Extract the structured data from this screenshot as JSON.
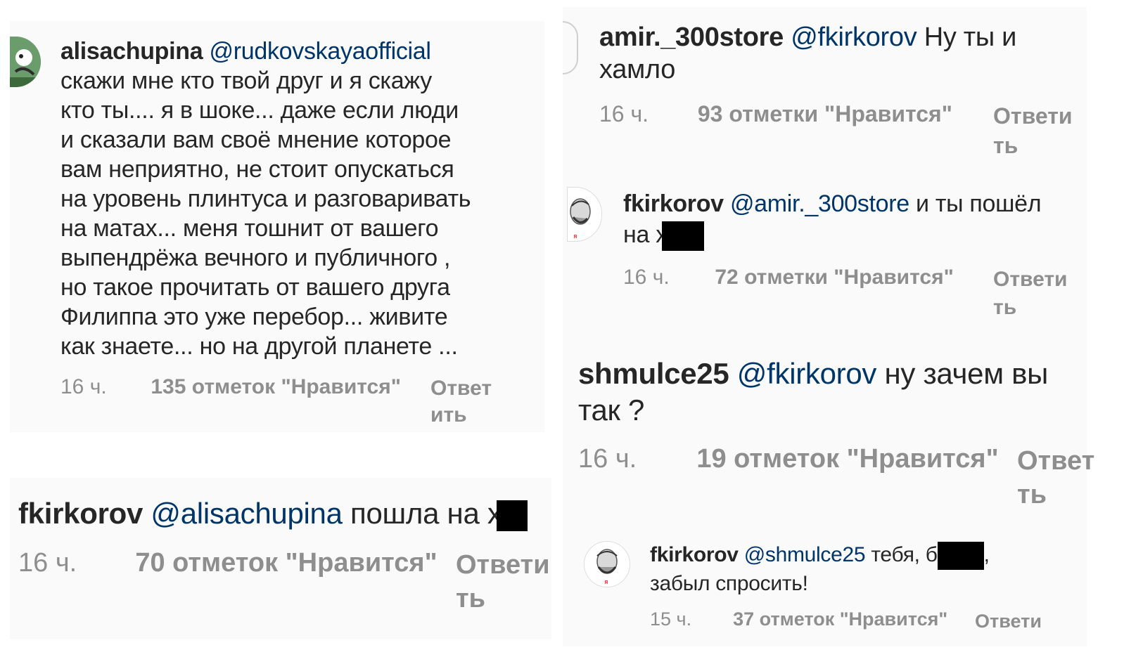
{
  "comments": [
    {
      "username": "alisachupina",
      "mention": "@rudkovskayaofficial",
      "lines": [
        "скажи мне кто твой друг и я скажу",
        "кто ты.... я в шоке... даже если люди",
        "и сказали вам своё мнение которое",
        "вам неприятно, не стоит опускаться",
        "на уровень плинтуса и разговаривать",
        "на матах... меня тошнит от вашего",
        "выпендрёжа вечного и публичного ,",
        "но такое прочитать от вашего друга",
        "Филиппа это уже перебор... живите",
        "как знаете... но на другой планете ..."
      ],
      "time": "16 ч.",
      "likes": "135 отметок \"Нравится\"",
      "reply": [
        "Ответ",
        "ить"
      ]
    },
    {
      "username": "fkirkorov",
      "mention": "@alisachupina",
      "text": "пошла на х",
      "time": "16 ч.",
      "likes": "70 отметок \"Нравится\"",
      "reply": [
        "Ответи",
        "ть"
      ]
    },
    {
      "username": "amir._300store",
      "mention": "@fkirkorov",
      "text_line1": "Ну ты и",
      "text_line2": "хамло",
      "time": "16 ч.",
      "likes": "93 отметки \"Нравится\"",
      "reply": [
        "Ответи",
        "ть"
      ]
    },
    {
      "username": "fkirkorov",
      "mention": "@amir._300store",
      "text_line1": "и ты пошёл",
      "text_line2": "на х",
      "time": "16 ч.",
      "likes": "72 отметки \"Нравится\"",
      "reply": [
        "Ответи",
        "ть"
      ]
    },
    {
      "username": "shmulce25",
      "mention": "@fkirkorov",
      "text_line1": "ну зачем вы",
      "text_line2": "так ?",
      "time": "16 ч.",
      "likes": "19 отметок \"Нравится\"",
      "reply": [
        "Ответ",
        "ть"
      ]
    },
    {
      "username": "fkirkorov",
      "mention": "@shmulce25",
      "text_line1_pre": "тебя, б",
      "text_line1_post": ",",
      "text_line2": "забыл спросить!",
      "time": "15 ч.",
      "likes": "37 отметок \"Нравится\"",
      "reply": [
        "Ответи"
      ]
    }
  ],
  "colors": {
    "mention": "#003569",
    "meta": "#8e8e8e",
    "text": "#262626",
    "panel": "#fafafa",
    "redaction": "#000000"
  }
}
